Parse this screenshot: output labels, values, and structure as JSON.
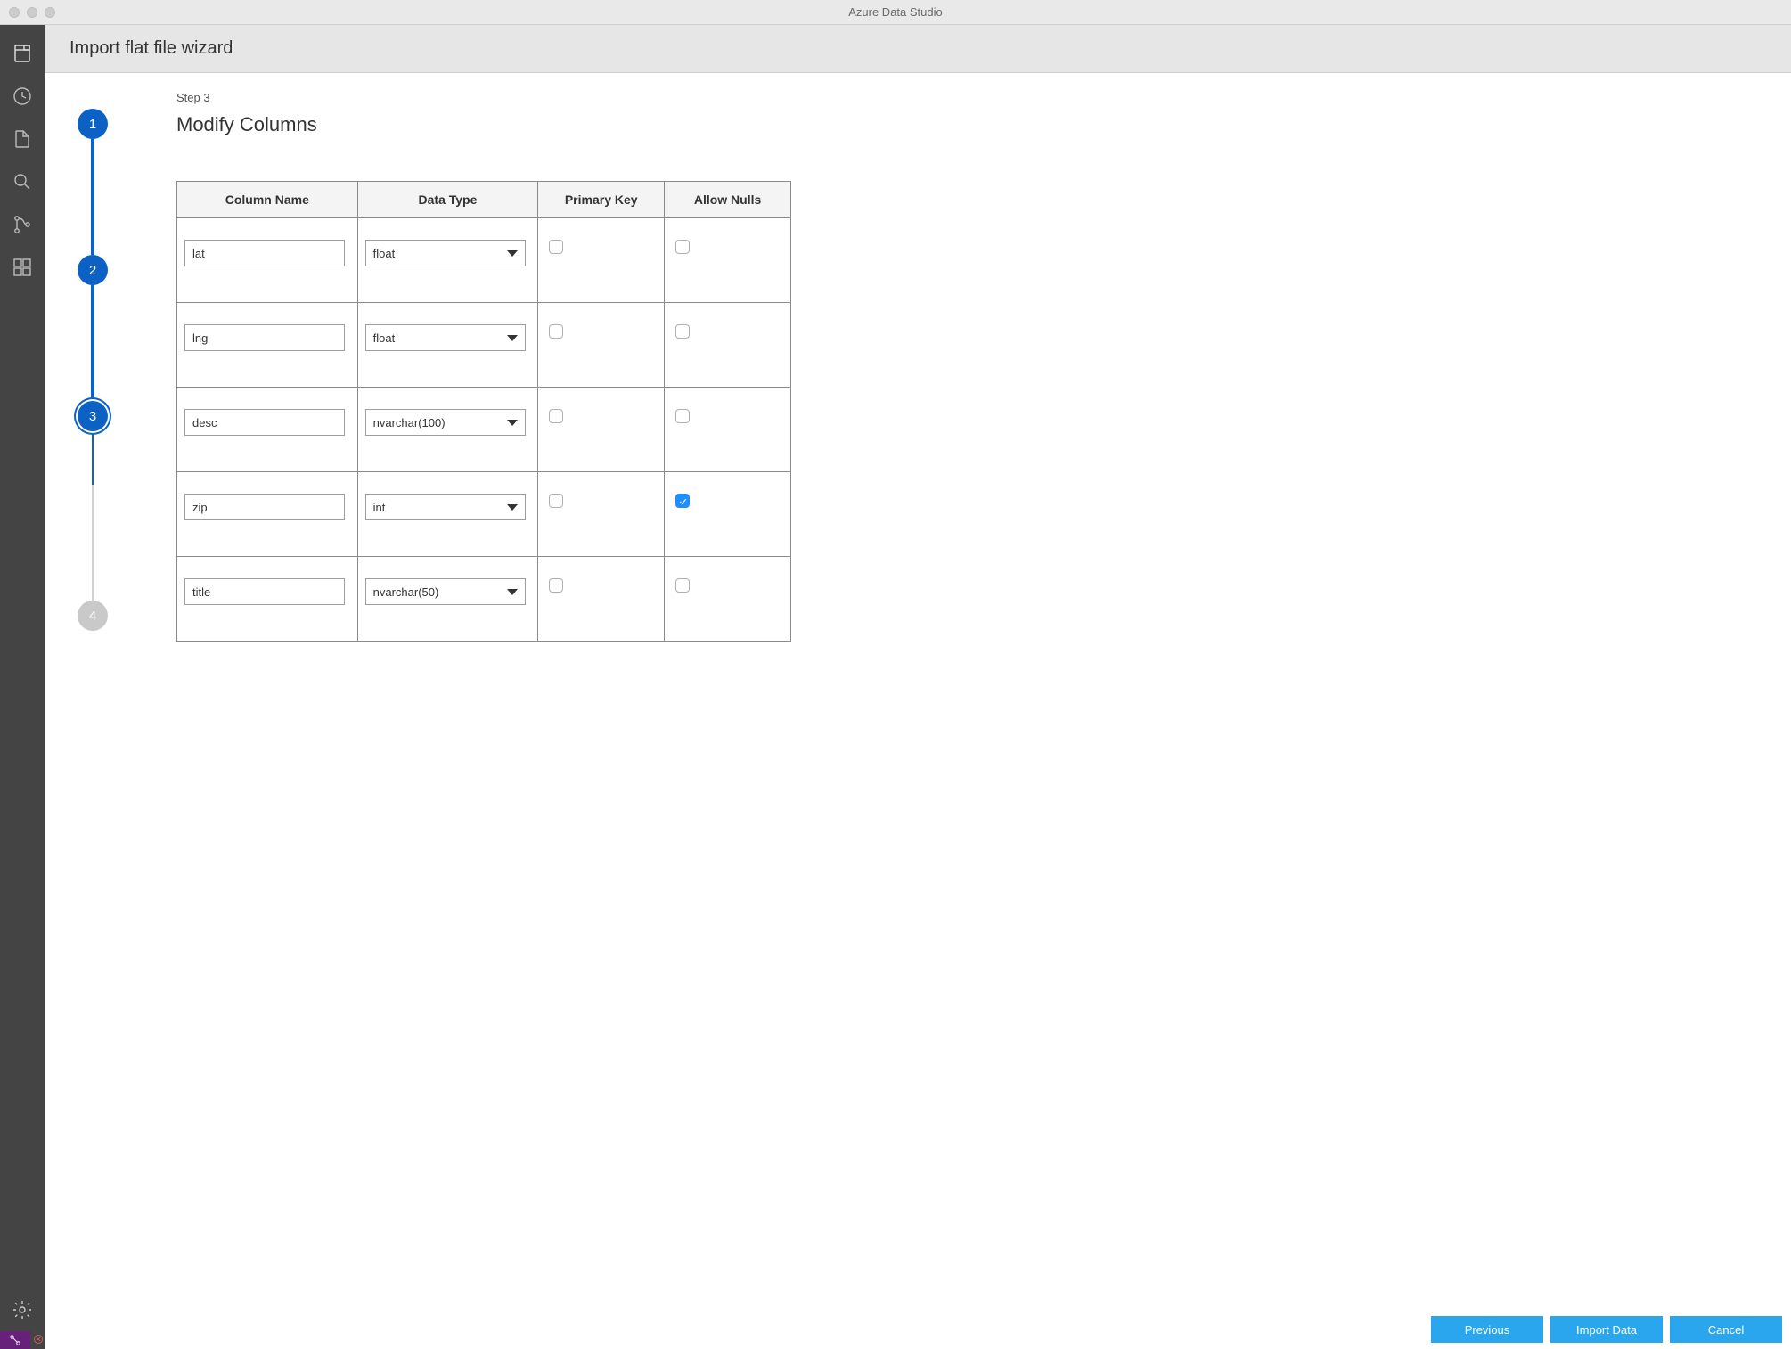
{
  "window": {
    "title": "Azure Data Studio"
  },
  "header": {
    "title": "Import flat file wizard"
  },
  "stepper": {
    "steps": [
      "1",
      "2",
      "3",
      "4"
    ],
    "currentIndex": 2
  },
  "page": {
    "step_label": "Step 3",
    "heading": "Modify Columns"
  },
  "table": {
    "headers": {
      "col_name": "Column Name",
      "data_type": "Data Type",
      "primary_key": "Primary Key",
      "allow_nulls": "Allow Nulls"
    },
    "rows": [
      {
        "name": "lat",
        "type": "float",
        "pk": false,
        "nulls": false
      },
      {
        "name": "lng",
        "type": "float",
        "pk": false,
        "nulls": false
      },
      {
        "name": "desc",
        "type": "nvarchar(100)",
        "pk": false,
        "nulls": false
      },
      {
        "name": "zip",
        "type": "int",
        "pk": false,
        "nulls": true
      },
      {
        "name": "title",
        "type": "nvarchar(50)",
        "pk": false,
        "nulls": false
      }
    ]
  },
  "footer": {
    "previous": "Previous",
    "import": "Import Data",
    "cancel": "Cancel"
  }
}
